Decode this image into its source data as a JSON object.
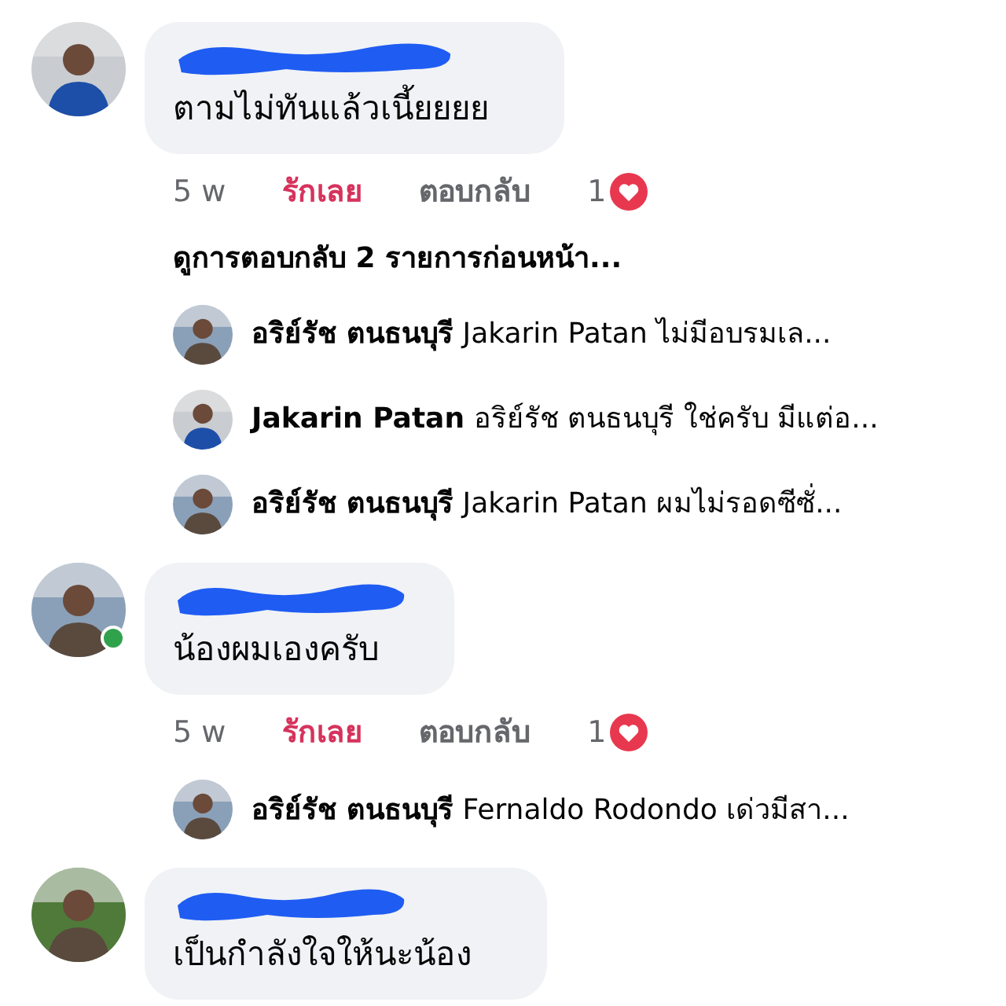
{
  "comments": [
    {
      "online": false,
      "text": "ตามไม่ทันแล้วเนี้ยยยย",
      "time": "5 w",
      "like_label": "รักเลย",
      "liked": true,
      "reply_label": "ตอบกลับ",
      "reaction_count": "1",
      "more_replies": "ดูการตอบกลับ 2 รายการก่อนหน้า...",
      "replies": [
        {
          "author": "อริย์รัช ตนธนบุรี",
          "text": "Jakarin Patan ไม่มีอบรมเล..."
        },
        {
          "author": "Jakarin Patan",
          "text": "อริย์รัช ตนธนบุรี ใช่ครับ มีแต่อ..."
        },
        {
          "author": "อริย์รัช ตนธนบุรี",
          "text": "Jakarin Patan ผมไม่รอดซีซั่..."
        }
      ]
    },
    {
      "online": true,
      "text": "น้องผมเองครับ",
      "time": "5 w",
      "like_label": "รักเลย",
      "liked": true,
      "reply_label": "ตอบกลับ",
      "reaction_count": "1",
      "replies": [
        {
          "author": "อริย์รัช ตนธนบุรี",
          "text": "Fernaldo Rodondo เด่วมีสา..."
        }
      ]
    },
    {
      "online": false,
      "text": "เป็นกำลังใจให้นะน้อง"
    }
  ]
}
